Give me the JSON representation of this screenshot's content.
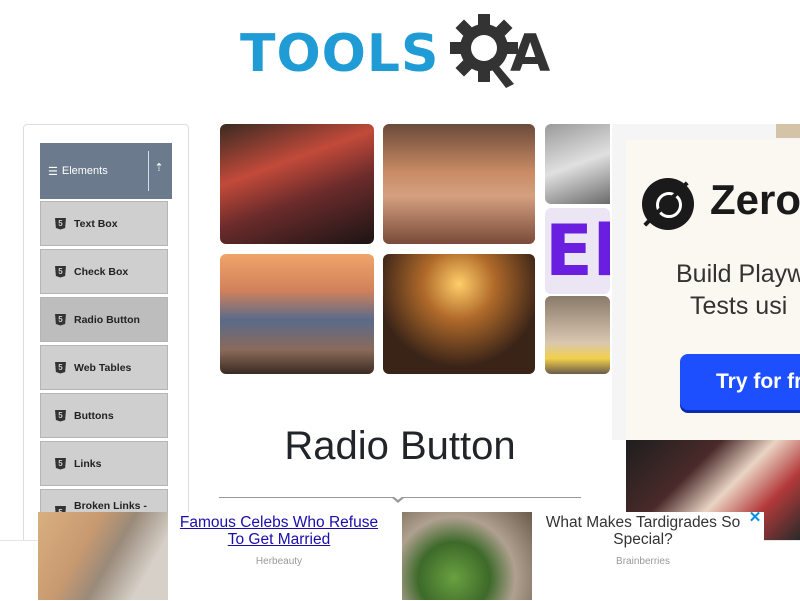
{
  "header": {
    "logo_text": "TOOLS",
    "logo_suffix": "A"
  },
  "sidebar": {
    "group_title": "Elements",
    "items": [
      {
        "label": "Text Box"
      },
      {
        "label": "Check Box"
      },
      {
        "label": "Radio Button",
        "active": true
      },
      {
        "label": "Web Tables"
      },
      {
        "label": "Buttons"
      },
      {
        "label": "Links"
      },
      {
        "label": "Broken Links -"
      }
    ]
  },
  "side_ad": {
    "brand": "Zero",
    "line1": "Build Playw",
    "line2": "Tests usi",
    "cta": "Try for fr",
    "accent_color": "#1e4fff"
  },
  "banner": {
    "tile_letter": "El"
  },
  "main": {
    "title": "Radio Button"
  },
  "bottom_ad": {
    "left": {
      "title": "Famous Celebs Who Refuse To Get Married",
      "source": "Herbeauty"
    },
    "right": {
      "title": "What Makes Tardigrades So Special?",
      "source": "Brainberries"
    },
    "close_glyph": "✕"
  },
  "icons": [
    "gear-icon",
    "hamburger-icon",
    "collapse-arrow-icon",
    "html5-icon",
    "close-icon"
  ],
  "colors": {
    "logo_blue": "#1f9bd5",
    "menu_header": "#6b7a8d",
    "menu_item": "#cfcfcf",
    "link": "#1a0dab"
  }
}
